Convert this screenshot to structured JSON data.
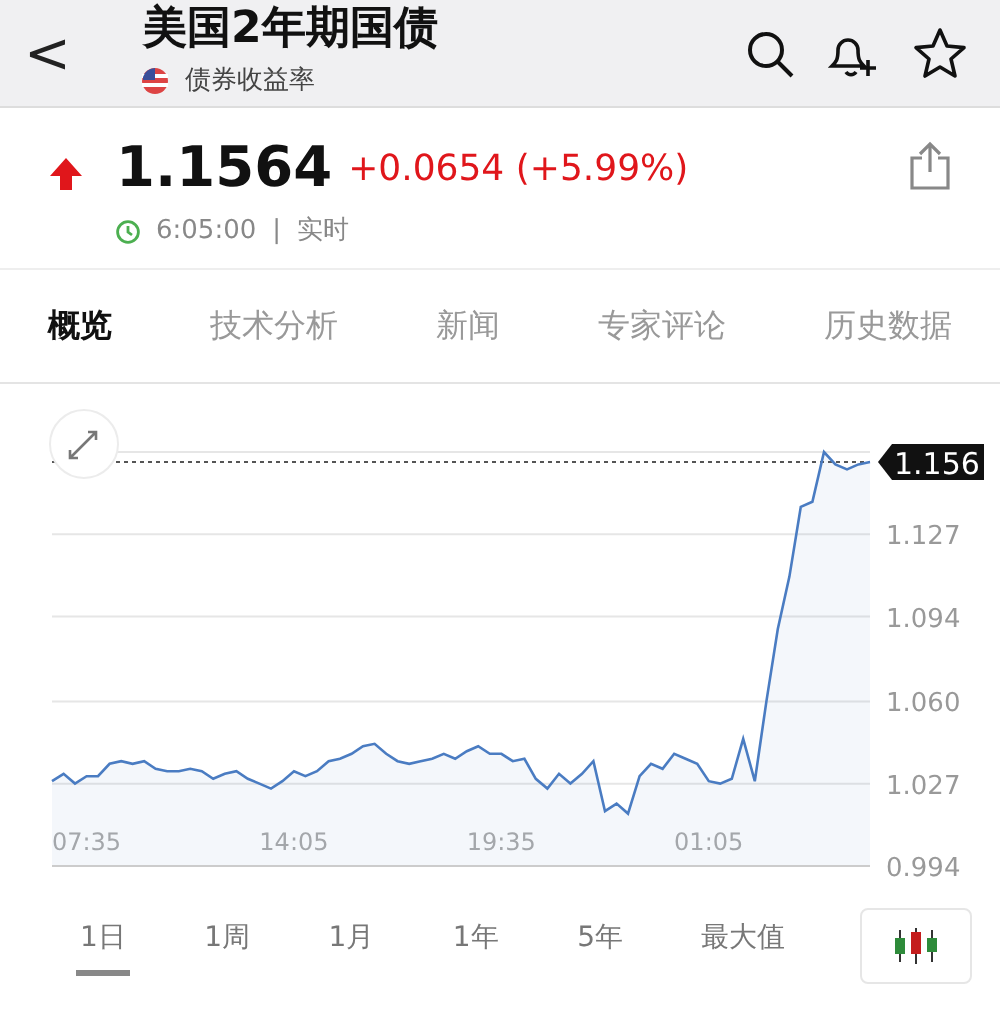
{
  "header": {
    "back": "<",
    "title": "美国2年期国债",
    "subtitle": "债券收益率"
  },
  "quote": {
    "up": true,
    "price": "1.1564",
    "change": "+0.0654 (+5.99%)",
    "time": "6:05:00",
    "separator": "|",
    "mode": "实时"
  },
  "tabs": [
    {
      "label": "概览",
      "selected": true
    },
    {
      "label": "技术分析",
      "selected": false
    },
    {
      "label": "新闻",
      "selected": false
    },
    {
      "label": "专家评论",
      "selected": false
    },
    {
      "label": "历史数据",
      "selected": false
    }
  ],
  "chart": {
    "chart_data": {
      "type": "area",
      "grid": true,
      "categories": [
        null,
        null,
        null,
        "07:35",
        null,
        null,
        null,
        null,
        null,
        null,
        null,
        null,
        null,
        null,
        null,
        null,
        null,
        null,
        null,
        null,
        null,
        "14:05",
        null,
        null,
        null,
        null,
        null,
        null,
        null,
        null,
        null,
        null,
        null,
        null,
        null,
        null,
        null,
        null,
        null,
        "19:35",
        null,
        null,
        null,
        null,
        null,
        null,
        null,
        null,
        null,
        null,
        null,
        null,
        null,
        null,
        null,
        null,
        null,
        "01:05",
        null,
        null,
        null,
        null,
        null,
        null,
        null,
        null,
        null,
        null,
        null,
        null,
        null,
        null
      ],
      "ylim": [
        0.994,
        1.16
      ],
      "yticks": [
        {
          "value": 0.994,
          "label": "0.994"
        },
        {
          "value": 1.027,
          "label": "1.027"
        },
        {
          "value": 1.06,
          "label": "1.060"
        },
        {
          "value": 1.094,
          "label": "1.094"
        },
        {
          "value": 1.127,
          "label": "1.127"
        }
      ],
      "ref_lines": [
        {
          "axis": "y",
          "value": 1.156,
          "label": "1.156",
          "color": "#555555"
        }
      ],
      "series": [
        {
          "color": "#4a7cc2",
          "values": [
            1.028,
            1.031,
            1.027,
            1.03,
            1.03,
            1.035,
            1.036,
            1.035,
            1.036,
            1.033,
            1.032,
            1.032,
            1.033,
            1.032,
            1.029,
            1.031,
            1.032,
            1.029,
            1.027,
            1.025,
            1.028,
            1.032,
            1.03,
            1.032,
            1.036,
            1.037,
            1.039,
            1.042,
            1.043,
            1.039,
            1.036,
            1.035,
            1.036,
            1.037,
            1.039,
            1.037,
            1.04,
            1.042,
            1.039,
            1.039,
            1.036,
            1.037,
            1.029,
            1.025,
            1.031,
            1.027,
            1.031,
            1.036,
            1.016,
            1.019,
            1.015,
            1.03,
            1.035,
            1.033,
            1.039,
            1.037,
            1.035,
            1.028,
            1.027,
            1.029,
            1.045,
            1.028,
            1.06,
            1.089,
            1.11,
            1.138,
            1.14,
            1.16,
            1.155,
            1.153,
            1.155,
            1.156
          ]
        }
      ]
    }
  },
  "ranges": [
    {
      "label": "1日",
      "selected": true
    },
    {
      "label": "1周",
      "selected": false
    },
    {
      "label": "1月",
      "selected": false
    },
    {
      "label": "1年",
      "selected": false
    },
    {
      "label": "5年",
      "selected": false
    },
    {
      "label": "最大值",
      "selected": false
    }
  ]
}
